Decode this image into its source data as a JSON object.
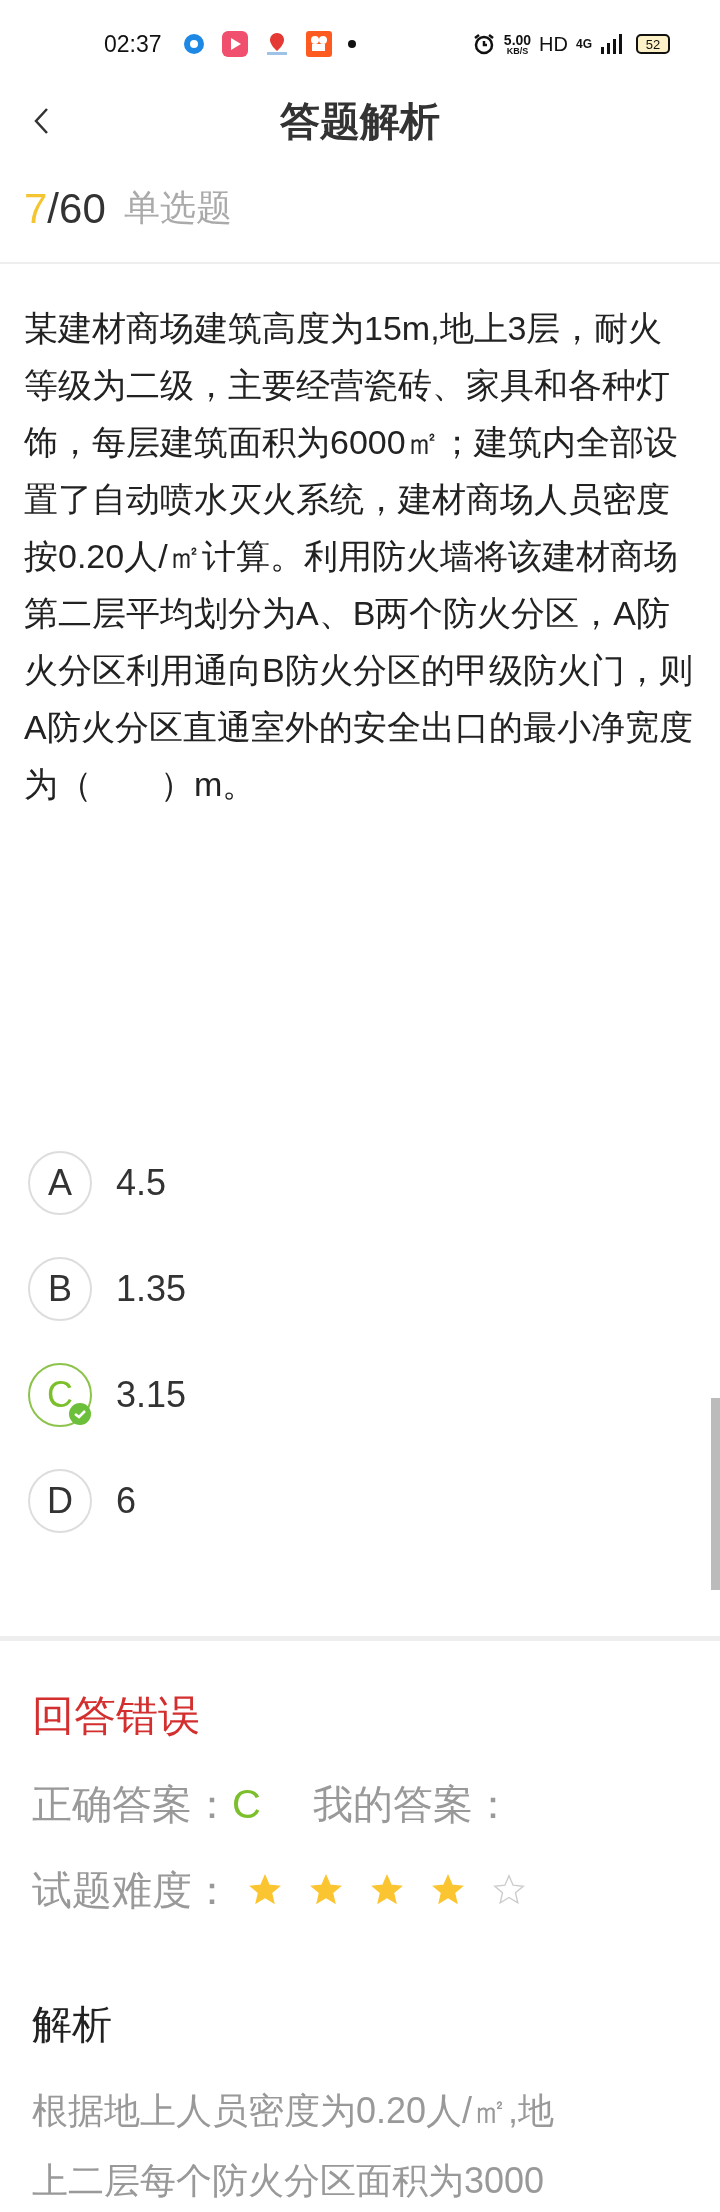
{
  "status_bar": {
    "time": "02:37",
    "net_speed": "5.00",
    "net_unit": "KB/S",
    "hd": "HD",
    "network": "4G",
    "battery": "52"
  },
  "header": {
    "title": "答题解析"
  },
  "progress": {
    "current": "7",
    "total": "/60",
    "type": "单选题"
  },
  "question": "某建材商场建筑高度为15m,地上3层，耐火等级为二级，主要经营瓷砖、家具和各种灯饰，每层建筑面积为6000㎡；建筑内全部设置了自动喷水灭火系统，建材商场人员密度按0.20人/㎡计算。利用防火墙将该建材商场第二层平均划分为A、B两个防火分区，A防火分区利用通向B防火分区的甲级防火门，则A防火分区直通室外的安全出口的最小净宽度为（　　）m。",
  "options": [
    {
      "letter": "A",
      "text": "4.5",
      "correct": false
    },
    {
      "letter": "B",
      "text": "1.35",
      "correct": false
    },
    {
      "letter": "C",
      "text": "3.15",
      "correct": true
    },
    {
      "letter": "D",
      "text": "6",
      "correct": false
    }
  ],
  "result": {
    "status": "回答错误",
    "correct_label": "正确答案：",
    "correct_answer": "C",
    "my_label": "我的答案：",
    "difficulty_label": "试题难度：",
    "stars": 4
  },
  "analysis": {
    "title": "解析",
    "lines": [
      "根据地上人员密度为0.20人/㎡,地",
      "上二层每个防火分区面积为3000"
    ]
  }
}
